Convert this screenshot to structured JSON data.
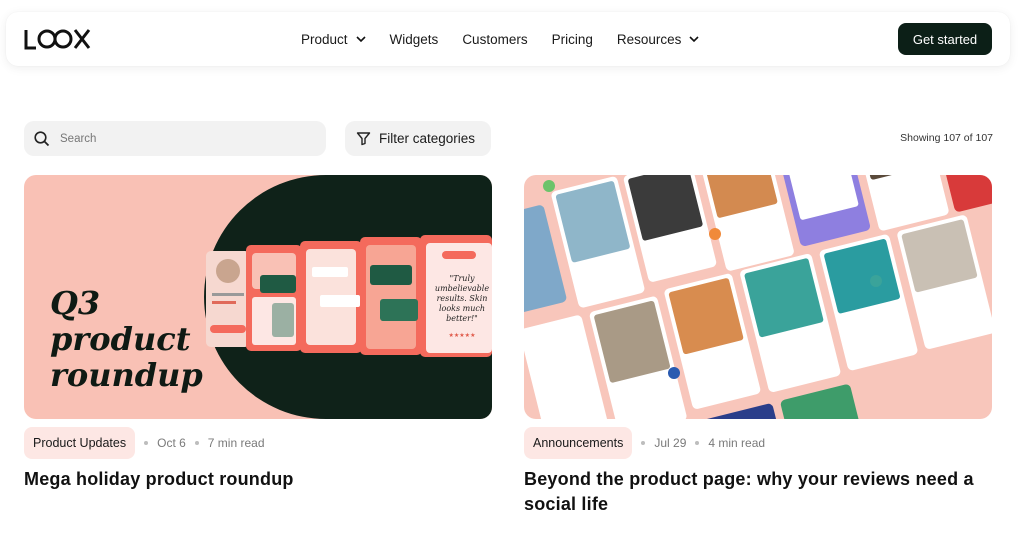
{
  "nav": {
    "logo_text": "LOOX",
    "links": [
      {
        "label": "Product",
        "has_dropdown": true
      },
      {
        "label": "Widgets",
        "has_dropdown": false
      },
      {
        "label": "Customers",
        "has_dropdown": false
      },
      {
        "label": "Pricing",
        "has_dropdown": false
      },
      {
        "label": "Resources",
        "has_dropdown": true
      }
    ],
    "cta_label": "Get started"
  },
  "toolbar": {
    "search_placeholder": "Search",
    "filter_label": "Filter categories",
    "showing_text": "Showing 107 of 107"
  },
  "posts": [
    {
      "category": "Product Updates",
      "date": "Oct 6",
      "read_time": "7 min read",
      "title": "Mega holiday product roundup",
      "image_heading": "Q3 product roundup"
    },
    {
      "category": "Announcements",
      "date": "Jul 29",
      "read_time": "4 min read",
      "title": "Beyond the product page: why your reviews need a social life"
    }
  ],
  "colors": {
    "cta_bg": "#0c1f17",
    "tag_bg": "#fde7e4",
    "card1_bg": "#f9c1b5",
    "card1_dark": "#0f2219",
    "card2_bg": "#f8c6bb"
  },
  "icons": {
    "search": "search-icon",
    "filter": "filter-icon",
    "dropdown": "chevron-down-icon"
  }
}
